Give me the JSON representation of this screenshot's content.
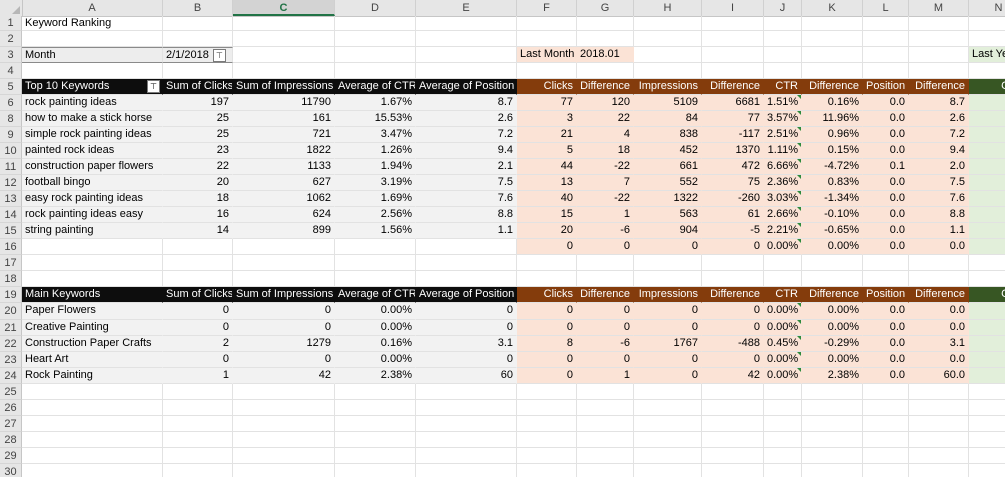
{
  "columns": [
    "A",
    "B",
    "C",
    "D",
    "E",
    "F",
    "G",
    "H",
    "I",
    "J",
    "K",
    "L",
    "M",
    "N"
  ],
  "selected_column": "C",
  "title": "Keyword Ranking",
  "month": {
    "label": "Month",
    "value": "2/1/2018"
  },
  "last_month": {
    "label": "Last Month",
    "value": "2018.01"
  },
  "last_year": {
    "label": "Last Yea"
  },
  "top_header": {
    "a": "Top 10 Keywords",
    "b": "Sum of Clicks",
    "c": "Sum of Impressions",
    "d": "Average of CTR",
    "e": "Average of Position",
    "f": "Clicks",
    "g": "Difference",
    "h": "Impressions",
    "i": "Difference",
    "j": "CTR",
    "k": "Difference",
    "l": "Position",
    "m": "Difference",
    "n": "Click"
  },
  "top_rows": [
    {
      "a": "rock painting ideas",
      "b": "197",
      "c": "11790",
      "d": "1.67%",
      "e": "8.7",
      "f": "77",
      "g": "120",
      "h": "5109",
      "i": "6681",
      "j": "1.51%",
      "k": "0.16%",
      "l": "0.0",
      "m": "8.7"
    },
    {
      "a": "how to make a stick horse",
      "b": "25",
      "c": "161",
      "d": "15.53%",
      "e": "2.6",
      "f": "3",
      "g": "22",
      "h": "84",
      "i": "77",
      "j": "3.57%",
      "k": "11.96%",
      "l": "0.0",
      "m": "2.6"
    },
    {
      "a": "simple rock painting ideas",
      "b": "25",
      "c": "721",
      "d": "3.47%",
      "e": "7.2",
      "f": "21",
      "g": "4",
      "h": "838",
      "i": "-117",
      "j": "2.51%",
      "k": "0.96%",
      "l": "0.0",
      "m": "7.2"
    },
    {
      "a": "painted rock ideas",
      "b": "23",
      "c": "1822",
      "d": "1.26%",
      "e": "9.4",
      "f": "5",
      "g": "18",
      "h": "452",
      "i": "1370",
      "j": "1.11%",
      "k": "0.15%",
      "l": "0.0",
      "m": "9.4"
    },
    {
      "a": "construction paper flowers",
      "b": "22",
      "c": "1133",
      "d": "1.94%",
      "e": "2.1",
      "f": "44",
      "g": "-22",
      "h": "661",
      "i": "472",
      "j": "6.66%",
      "k": "-4.72%",
      "l": "0.1",
      "m": "2.0"
    },
    {
      "a": "football bingo",
      "b": "20",
      "c": "627",
      "d": "3.19%",
      "e": "7.5",
      "f": "13",
      "g": "7",
      "h": "552",
      "i": "75",
      "j": "2.36%",
      "k": "0.83%",
      "l": "0.0",
      "m": "7.5"
    },
    {
      "a": "easy rock painting ideas",
      "b": "18",
      "c": "1062",
      "d": "1.69%",
      "e": "7.6",
      "f": "40",
      "g": "-22",
      "h": "1322",
      "i": "-260",
      "j": "3.03%",
      "k": "-1.34%",
      "l": "0.0",
      "m": "7.6"
    },
    {
      "a": "rock painting ideas easy",
      "b": "16",
      "c": "624",
      "d": "2.56%",
      "e": "8.8",
      "f": "15",
      "g": "1",
      "h": "563",
      "i": "61",
      "j": "2.66%",
      "k": "-0.10%",
      "l": "0.0",
      "m": "8.8"
    },
    {
      "a": "string painting",
      "b": "14",
      "c": "899",
      "d": "1.56%",
      "e": "1.1",
      "f": "20",
      "g": "-6",
      "h": "904",
      "i": "-5",
      "j": "2.21%",
      "k": "-0.65%",
      "l": "0.0",
      "m": "1.1"
    },
    {
      "a": "",
      "b": "",
      "c": "",
      "d": "",
      "e": "",
      "f": "0",
      "g": "0",
      "h": "0",
      "i": "0",
      "j": "0.00%",
      "k": "0.00%",
      "l": "0.0",
      "m": "0.0"
    }
  ],
  "main_header": {
    "a": "Main Keywords",
    "b": "Sum of Clicks",
    "c": "Sum of Impressions",
    "d": "Average of CTR",
    "e": "Average of Position",
    "f": "Clicks",
    "g": "Difference",
    "h": "Impressions",
    "i": "Difference",
    "j": "CTR",
    "k": "Difference",
    "l": "Position",
    "m": "Difference",
    "n": "Click"
  },
  "main_rows": [
    {
      "a": "Paper Flowers",
      "b": "0",
      "c": "0",
      "d": "0.00%",
      "e": "0",
      "f": "0",
      "g": "0",
      "h": "0",
      "i": "0",
      "j": "0.00%",
      "k": "0.00%",
      "l": "0.0",
      "m": "0.0"
    },
    {
      "a": "Creative Painting",
      "b": "0",
      "c": "0",
      "d": "0.00%",
      "e": "0",
      "f": "0",
      "g": "0",
      "h": "0",
      "i": "0",
      "j": "0.00%",
      "k": "0.00%",
      "l": "0.0",
      "m": "0.0"
    },
    {
      "a": "Construction Paper Crafts",
      "b": "2",
      "c": "1279",
      "d": "0.16%",
      "e": "3.1",
      "f": "8",
      "g": "-6",
      "h": "1767",
      "i": "-488",
      "j": "0.45%",
      "k": "-0.29%",
      "l": "0.0",
      "m": "3.1"
    },
    {
      "a": "Heart Art",
      "b": "0",
      "c": "0",
      "d": "0.00%",
      "e": "0",
      "f": "0",
      "g": "0",
      "h": "0",
      "i": "0",
      "j": "0.00%",
      "k": "0.00%",
      "l": "0.0",
      "m": "0.0"
    },
    {
      "a": "Rock Painting",
      "b": "1",
      "c": "42",
      "d": "2.38%",
      "e": "60",
      "f": "0",
      "g": "1",
      "h": "0",
      "i": "42",
      "j": "0.00%",
      "k": "2.38%",
      "l": "0.0",
      "m": "60.0"
    }
  ],
  "colors": {
    "black_header": "#0d0d0d",
    "brown_header": "#843c0c",
    "green_header": "#375623",
    "peach": "#fbe3d6",
    "gray": "#f2f2f2",
    "light_green": "#e2efda"
  }
}
